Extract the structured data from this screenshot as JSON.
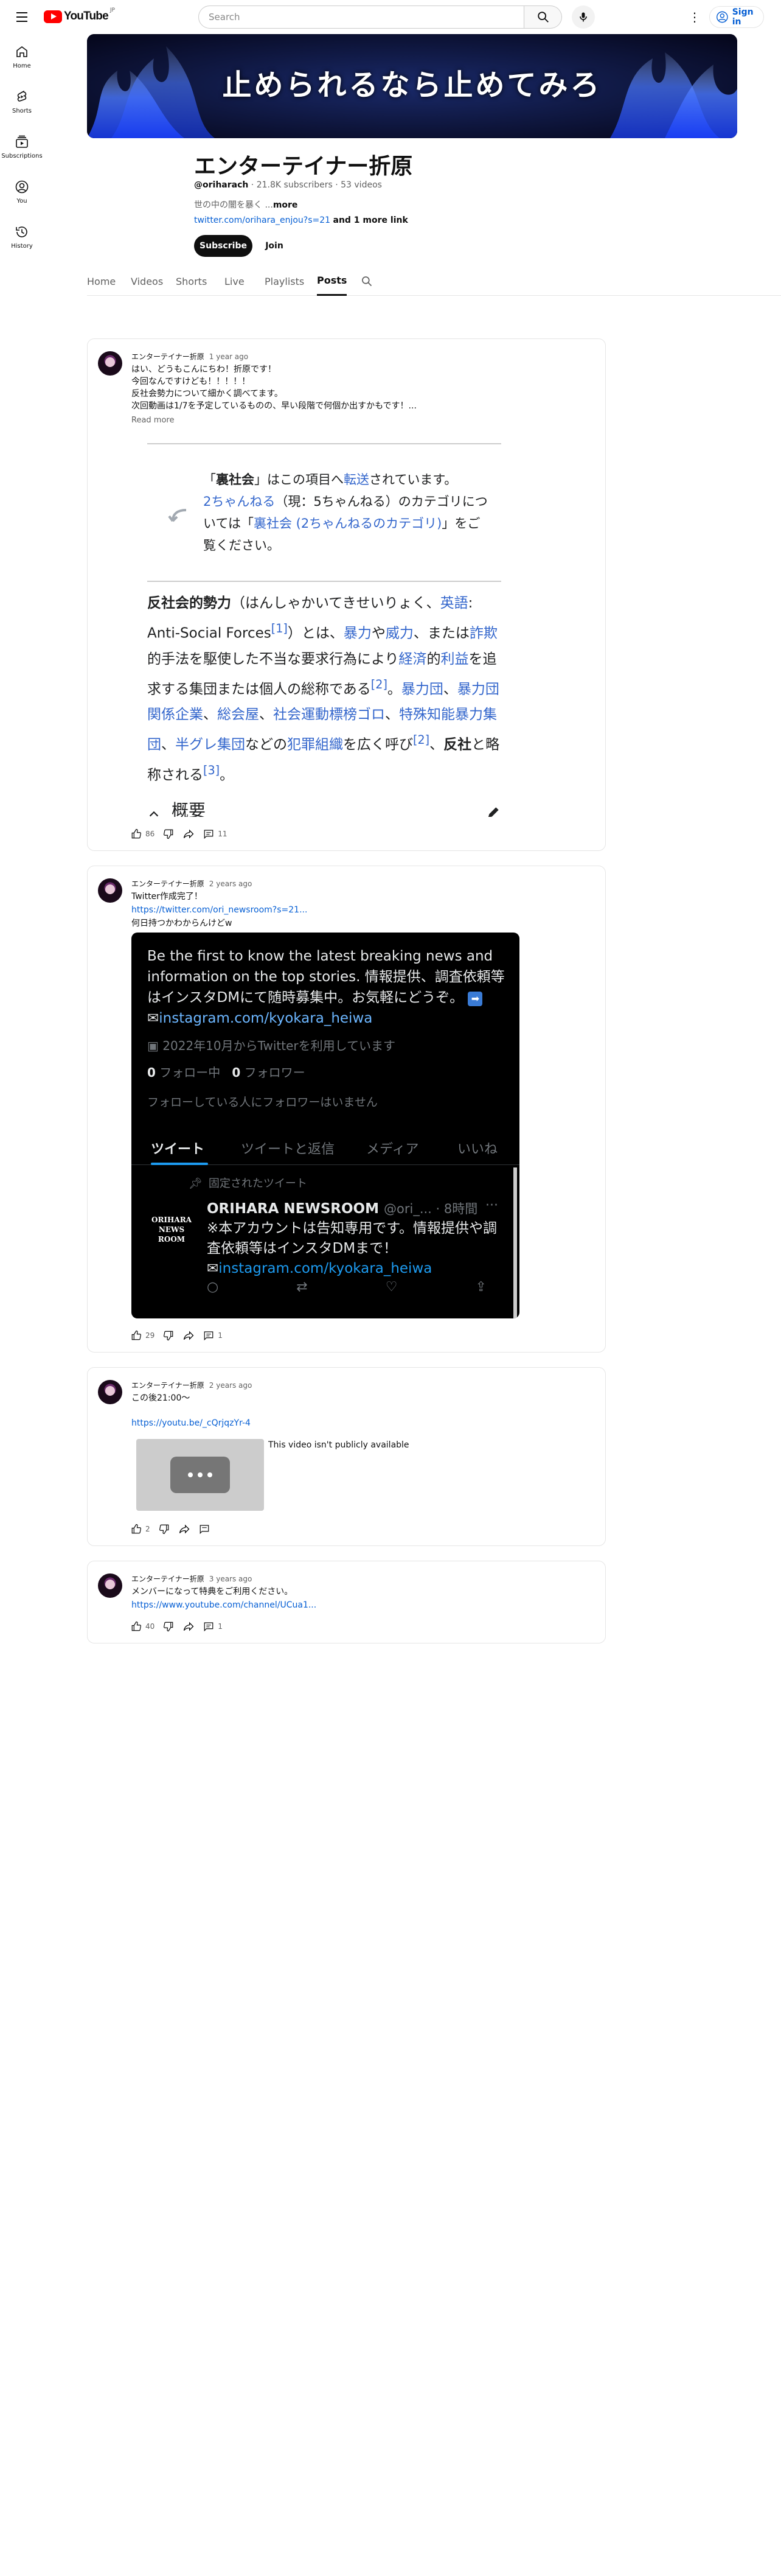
{
  "header": {
    "logo_text": "YouTube",
    "logo_badge": "JP",
    "search_placeholder": "Search",
    "signin_label": "Sign in"
  },
  "sidebar": {
    "items": [
      {
        "label": "Home",
        "icon": "home-icon"
      },
      {
        "label": "Shorts",
        "icon": "shorts-icon"
      },
      {
        "label": "Subscriptions",
        "icon": "subscriptions-icon"
      },
      {
        "label": "You",
        "icon": "you-icon"
      },
      {
        "label": "History",
        "icon": "history-icon"
      }
    ]
  },
  "banner": {
    "title": "止められるなら止めてみろ"
  },
  "channel": {
    "name": "エンターテイナー折原",
    "handle": "@oriharach",
    "subscribers": "21.8K subscribers",
    "videos": "53 videos",
    "description": "世の中の闇を暴く ...",
    "description_more": "more",
    "link": "twitter.com/orihara_enjou?s=21",
    "link_more": "and 1 more link",
    "subscribe_label": "Subscribe",
    "join_label": "Join"
  },
  "tabs": [
    {
      "label": "Home",
      "active": false
    },
    {
      "label": "Videos",
      "active": false
    },
    {
      "label": "Shorts",
      "active": false
    },
    {
      "label": "Live",
      "active": false
    },
    {
      "label": "Playlists",
      "active": false
    },
    {
      "label": "Posts",
      "active": true
    }
  ],
  "posts": [
    {
      "author": "エンターテイナー折原",
      "time": "1 year ago",
      "text": "はい、どうもこんにちわ！折原です！\n今回なんですけども！！！！！\n反社会勢力について細かく調べてます。\n次回動画は1/7を予定しているものの、早い段階で何個か出すかもです！...",
      "read_more": "Read more",
      "likes": "86",
      "comments": "11",
      "image": {
        "note_line1a": "「",
        "note_term": "裏社会",
        "note_line1b": "」はこの項目へ",
        "note_redirect": "転送",
        "note_line1c": "されています。",
        "note_line2_link": "2ちゃんねる",
        "note_line2_rest": "（現：5ちゃんねる）のカテゴリについては「",
        "note_line2_link2": "裏社会 (2ちゃんねるのカテゴリ)",
        "note_line2_end": "」をご覧ください。",
        "body_term": "反社会的勢力",
        "body_reading": "（はんしゃかいてきせいりょく、",
        "body_eng": "英語",
        "body_antisocial": ": Anti-Social Forces",
        "ref1": "[1]",
        "body_p1": "）とは、",
        "body_link_violence": "暴力",
        "body_p2": "や",
        "body_link_power": "威力",
        "body_p3": "、または",
        "body_link_fraud": "詐欺",
        "body_p4": "的手法を駆使した不当な要求行為により",
        "body_link_econ": "経済",
        "body_p5": "的",
        "body_link_profit": "利益",
        "body_p6": "を追求する集団または個人の総称である",
        "ref2": "[2]",
        "body_p7": "。",
        "body_link_gang": "暴力団",
        "body_sep1": "、",
        "body_link_gang_co": "暴力団関係企業",
        "body_sep2": "、",
        "body_link_sokaiya": "総会屋",
        "body_sep3": "、",
        "body_link_social": "社会運動標榜ゴロ",
        "body_sep4": "、",
        "body_link_special": "特殊知能暴力集団",
        "body_sep5": "、",
        "body_link_hangure": "半グレ集団",
        "body_p8": "などの",
        "body_link_crime": "犯罪組織",
        "body_p9": "を広く呼び",
        "ref2b": "[2]",
        "body_p10": "、",
        "body_hanshya": "反社",
        "body_p11": "と略称される",
        "ref3": "[3]",
        "body_p12": "。",
        "section_heading": "概要"
      }
    },
    {
      "author": "エンターテイナー折原",
      "time": "2 years ago",
      "text_line1": "Twitter作成完了！",
      "link": "https://twitter.com/ori_newsroom?s=21...",
      "text_line3": "何日持つかわからんけどw",
      "likes": "29",
      "comments": "1",
      "image": {
        "bio": "Be the first to know the latest breaking news and information on the top stories. 情報提供、調査依頼等はインスタDMにて随時募集中。お気軽にどうぞ。",
        "bio_link": "instagram.com/kyokara_heiwa",
        "joined": "2022年10月からTwitterを利用しています",
        "following_count": "0",
        "following_label": "フォロー中",
        "followers_count": "0",
        "followers_label": "フォロワー",
        "no_followers": "フォローしている人にフォロワーはいません",
        "tab_tweets": "ツイート",
        "tab_replies": "ツイートと返信",
        "tab_media": "メディア",
        "tab_likes": "いいね",
        "pinned": "固定されたツイート",
        "tweet_logo_l1": "ORIHARA",
        "tweet_logo_l2": "NEWS",
        "tweet_logo_l3": "ROOM",
        "tweet_name": "ORIHARA NEWSROOM",
        "tweet_handle": "@ori_... · 8時間",
        "tweet_text": "※本アカウントは告知専用です。情報提供や調査依頼等はインスタDMまで！",
        "tweet_link": "instagram.com/kyokara_heiwa"
      }
    },
    {
      "author": "エンターテイナー折原",
      "time": "2 years ago",
      "text": "この後21:00〜",
      "link": "https://youtu.be/_cQrjqzYr-4",
      "video_unavailable": "This video isn't publicly available",
      "likes": "2"
    },
    {
      "author": "エンターテイナー折原",
      "time": "3 years ago",
      "text": "メンバーになって特典をご利用ください。",
      "link": "https://www.youtube.com/channel/UCua1...",
      "likes": "40",
      "comments": "1"
    }
  ],
  "colors": {
    "brand_red": "#ff0000",
    "link_blue": "#065fd4",
    "wiki_link": "#3366cc",
    "twitter_blue": "#1d9bf0"
  }
}
